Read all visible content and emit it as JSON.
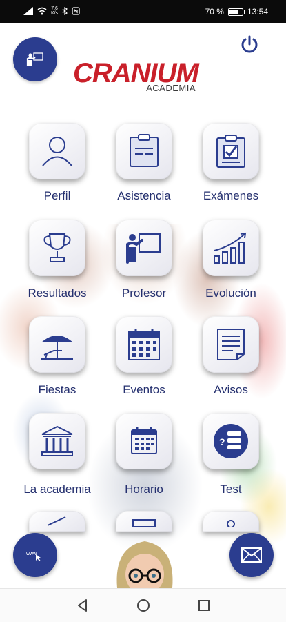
{
  "status_bar": {
    "speed_value": "7,6",
    "speed_unit": "K/s",
    "battery": "70 %",
    "battery_level": 0.7,
    "time": "13:54"
  },
  "header": {
    "logo_title": "CRANIUM",
    "logo_subtitle": "ACADEMIA",
    "left_button_icon": "teacher-board-icon",
    "right_button_icon": "power-icon"
  },
  "menu": {
    "perfil": "Perfil",
    "asistencia": "Asistencia",
    "examenes": "Exámenes",
    "resultados": "Resultados",
    "profesor": "Profesor",
    "evolucion": "Evolución",
    "fiestas": "Fiestas",
    "eventos": "Eventos",
    "avisos": "Avisos",
    "academia": "La academia",
    "horario": "Horario",
    "test": "Test"
  },
  "fabs": {
    "left_icon": "www-cursor-icon",
    "right_icon": "mail-icon"
  },
  "colors": {
    "brand_blue": "#2b3d8f",
    "label_blue": "#25306f",
    "logo_red": "#c9202a"
  }
}
